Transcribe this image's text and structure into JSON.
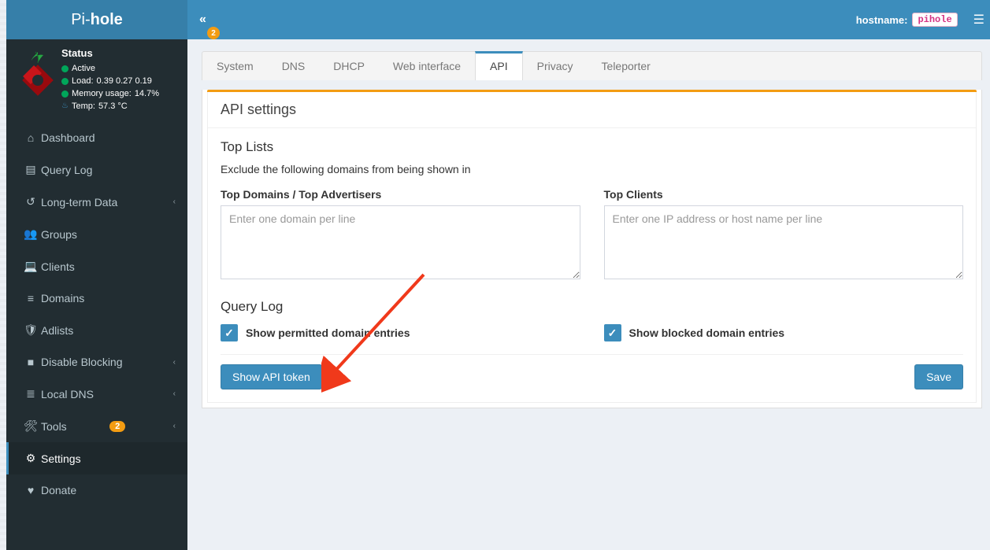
{
  "brand": {
    "prefix": "Pi-",
    "bold": "hole"
  },
  "status": {
    "title": "Status",
    "active": "Active",
    "load_label": "Load:",
    "load_values": "0.39  0.27  0.19",
    "mem_label": "Memory usage:",
    "mem_value": "14.7%",
    "temp_label": "Temp:",
    "temp_value": "57.3 °C"
  },
  "nav": {
    "dashboard": "Dashboard",
    "querylog": "Query Log",
    "longterm": "Long-term Data",
    "groups": "Groups",
    "clients": "Clients",
    "domains": "Domains",
    "adlists": "Adlists",
    "disable": "Disable Blocking",
    "localdns": "Local DNS",
    "tools": "Tools",
    "tools_badge": "2",
    "settings": "Settings",
    "donate": "Donate"
  },
  "topbar": {
    "collapse_badge": "2",
    "hostname_label": "hostname:",
    "hostname_value": "pihole"
  },
  "tabs": {
    "system": "System",
    "dns": "DNS",
    "dhcp": "DHCP",
    "web": "Web interface",
    "api": "API",
    "privacy": "Privacy",
    "teleporter": "Teleporter"
  },
  "panel": {
    "title": "API settings",
    "toplists_heading": "Top Lists",
    "toplists_sub": "Exclude the following domains from being shown in",
    "domains_label": "Top Domains / Top Advertisers",
    "domains_placeholder": "Enter one domain per line",
    "clients_label": "Top Clients",
    "clients_placeholder": "Enter one IP address or host name per line",
    "querylog_heading": "Query Log",
    "permitted_label": "Show permitted domain entries",
    "blocked_label": "Show blocked domain entries",
    "show_token_btn": "Show API token",
    "save_btn": "Save"
  }
}
